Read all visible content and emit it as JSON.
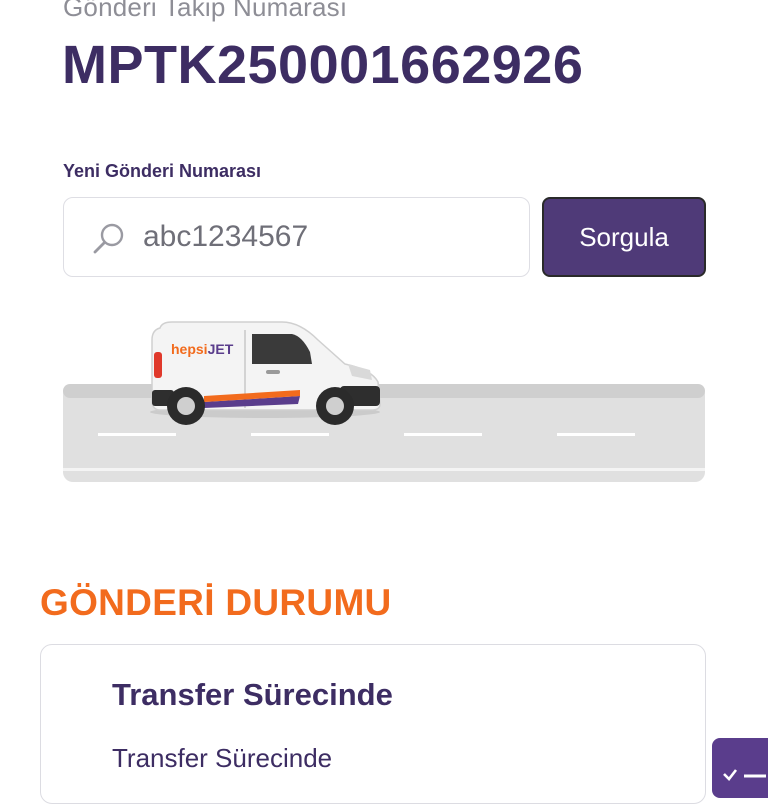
{
  "tracking": {
    "label": "Gönderi Takip Numarası",
    "number": "MPTK250001662926"
  },
  "search": {
    "label": "Yeni Gönderi Numarası",
    "value": "abc1234567",
    "button_label": "Sorgula"
  },
  "illustration": {
    "brand_prefix": "hepsi",
    "brand_suffix": "JET"
  },
  "status": {
    "section_title": "GÖNDERİ DURUMU",
    "title": "Transfer Sürecinde",
    "subtitle": "Transfer Sürecinde"
  },
  "colors": {
    "brand_purple": "#4f3a78",
    "heading_purple": "#3d2d63",
    "accent_orange": "#f26b1d"
  },
  "icons": {
    "search": "search-icon",
    "floating": "checklist-icon"
  }
}
